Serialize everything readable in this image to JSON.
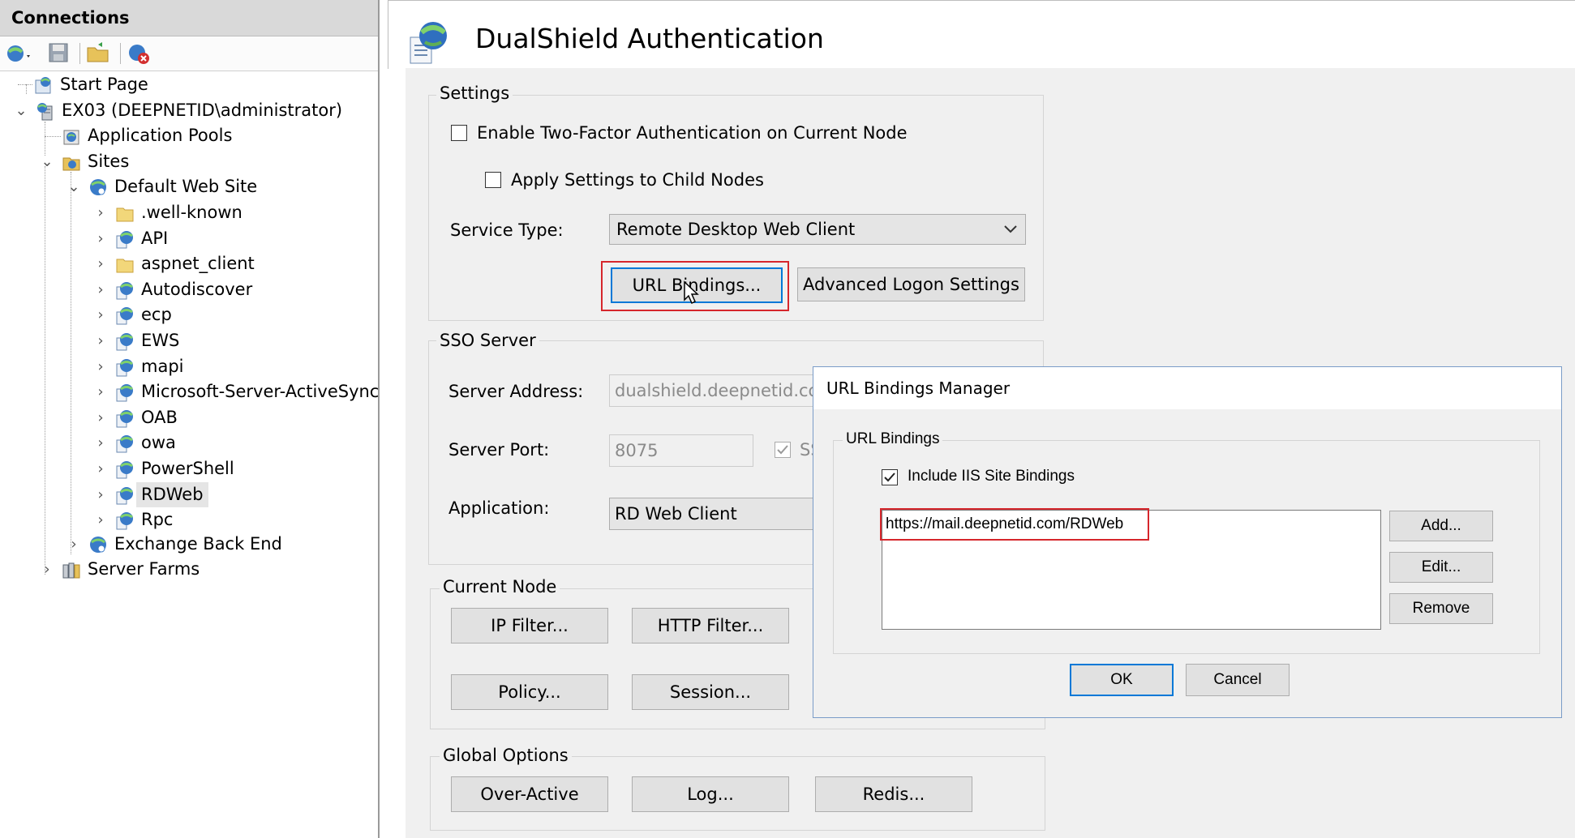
{
  "connections": {
    "title": "Connections",
    "toolbar": [
      {
        "icon": "connect-icon"
      },
      {
        "icon": "save-icon"
      },
      {
        "icon": "open-folder-icon"
      },
      {
        "icon": "disconnect-icon"
      }
    ],
    "tree": {
      "start_page": "Start Page",
      "server": "EX03 (DEEPNETID\\administrator)",
      "app_pools": "Application Pools",
      "sites": "Sites",
      "default_site": "Default Web Site",
      "children": [
        ".well-known",
        "API",
        "aspnet_client",
        "Autodiscover",
        "ecp",
        "EWS",
        "mapi",
        "Microsoft-Server-ActiveSync",
        "OAB",
        "owa",
        "PowerShell",
        "RDWeb",
        "Rpc"
      ],
      "exchange_back_end": "Exchange Back End",
      "server_farms": "Server Farms"
    }
  },
  "main": {
    "title": "DualShield Authentication",
    "settings": {
      "label": "Settings",
      "enable_2fa": "Enable Two-Factor Authentication on Current Node",
      "apply_child": "Apply Settings to Child Nodes",
      "service_type_label": "Service Type:",
      "service_type_value": "Remote Desktop Web Client",
      "url_bindings_btn": "URL Bindings...",
      "advanced_btn": "Advanced Logon Settings"
    },
    "sso": {
      "label": "SSO Server",
      "address_label": "Server Address:",
      "address_value": "dualshield.deepnetid.com",
      "port_label": "Server Port:",
      "port_value": "8075",
      "ssl_partial": "SS",
      "application_label": "Application:",
      "application_value": "RD Web Client"
    },
    "current_node": {
      "label": "Current Node",
      "ip_filter": "IP Filter...",
      "http_filter": "HTTP Filter...",
      "policy": "Policy...",
      "session": "Session..."
    },
    "global_options": {
      "label": "Global Options",
      "over_active": "Over-Active",
      "log": "Log...",
      "redis": "Redis..."
    }
  },
  "dialog": {
    "title": "URL Bindings Manager",
    "group_label": "URL Bindings",
    "include_iis": "Include IIS Site Bindings",
    "bindings": [
      "https://mail.deepnetid.com/RDWeb"
    ],
    "add": "Add...",
    "edit": "Edit...",
    "remove": "Remove",
    "ok": "OK",
    "cancel": "Cancel"
  }
}
